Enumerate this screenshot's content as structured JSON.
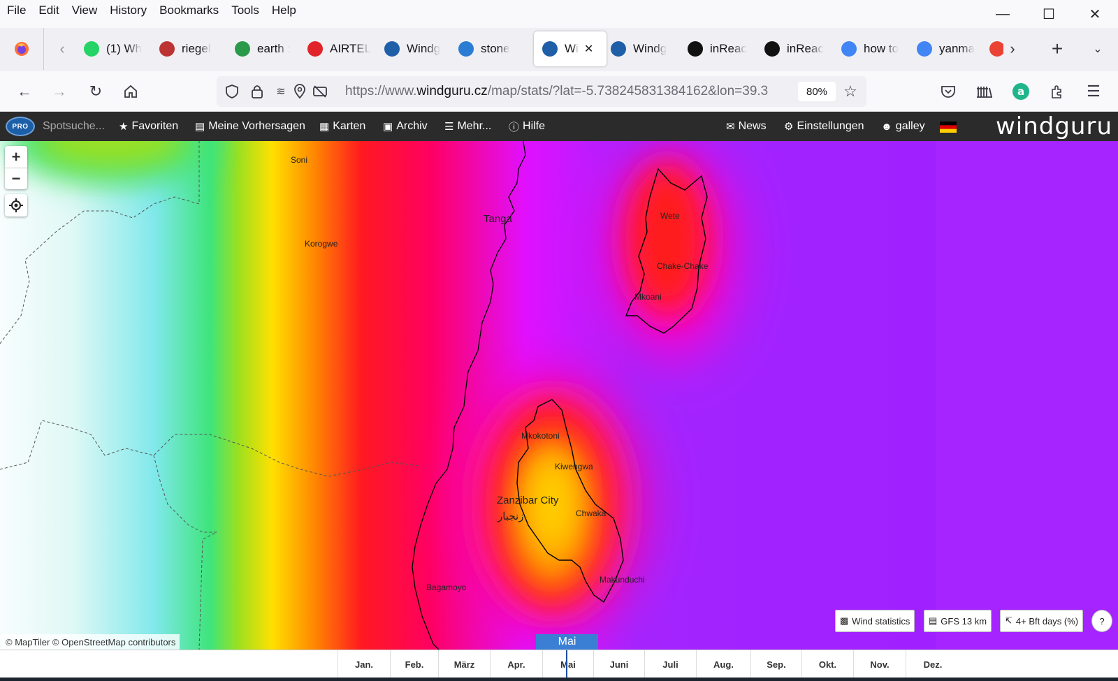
{
  "menubar": [
    "File",
    "Edit",
    "View",
    "History",
    "Bookmarks",
    "Tools",
    "Help"
  ],
  "tabs": [
    {
      "label": "(1) Wh",
      "color": "#25d366"
    },
    {
      "label": "riegel",
      "color": "#b33"
    },
    {
      "label": "earth :",
      "color": "#2a9a4a"
    },
    {
      "label": "AIRTEL",
      "color": "#e0242a"
    },
    {
      "label": "Windg",
      "color": "#1f5fa8"
    },
    {
      "label": "stone",
      "color": "#2b7cd3"
    },
    {
      "label": "Wi",
      "color": "#1f5fa8",
      "active": true
    },
    {
      "label": "Windg",
      "color": "#1f5fa8"
    },
    {
      "label": "inReac",
      "color": "#111"
    },
    {
      "label": "inReac",
      "color": "#111"
    },
    {
      "label": "how to",
      "color": "#4285f4"
    },
    {
      "label": "yanma",
      "color": "#4285f4"
    },
    {
      "label": "",
      "color": "#ea4335"
    }
  ],
  "url": {
    "prefix": "https://www.",
    "domain": "windguru.cz",
    "path": "/map/stats/?lat=-5.738245831384162&lon=39.3",
    "zoom": "80%"
  },
  "wg": {
    "pro": "PRO",
    "search": "Spotsuche...",
    "favoriten": "Favoriten",
    "vorhersagen": "Meine Vorhersagen",
    "karten": "Karten",
    "archiv": "Archiv",
    "mehr": "Mehr...",
    "hilfe": "Hilfe",
    "news": "News",
    "einstellungen": "Einstellungen",
    "user": "galley",
    "logo": "windguru"
  },
  "places": [
    "Soni",
    "Korogwe",
    "Tanga",
    "Wete",
    "Chake-Chake",
    "Mkoani",
    "Mkokotoni",
    "Kiwengwa",
    "Zanzibar City",
    "زنجبار",
    "Chwaka",
    "Makunduchi",
    "Bagamoyo"
  ],
  "attribution": "© MapTiler © OpenStreetMap contributors",
  "buttons": {
    "stats": "Wind statistics",
    "model": "GFS 13 km",
    "metric": "4+ Bft days (%)"
  },
  "current_month": "Mai",
  "months": [
    "Jan.",
    "Feb.",
    "März",
    "Apr.",
    "Mai",
    "Juni",
    "Juli",
    "Aug.",
    "Sep.",
    "Okt.",
    "Nov.",
    "Dez."
  ]
}
